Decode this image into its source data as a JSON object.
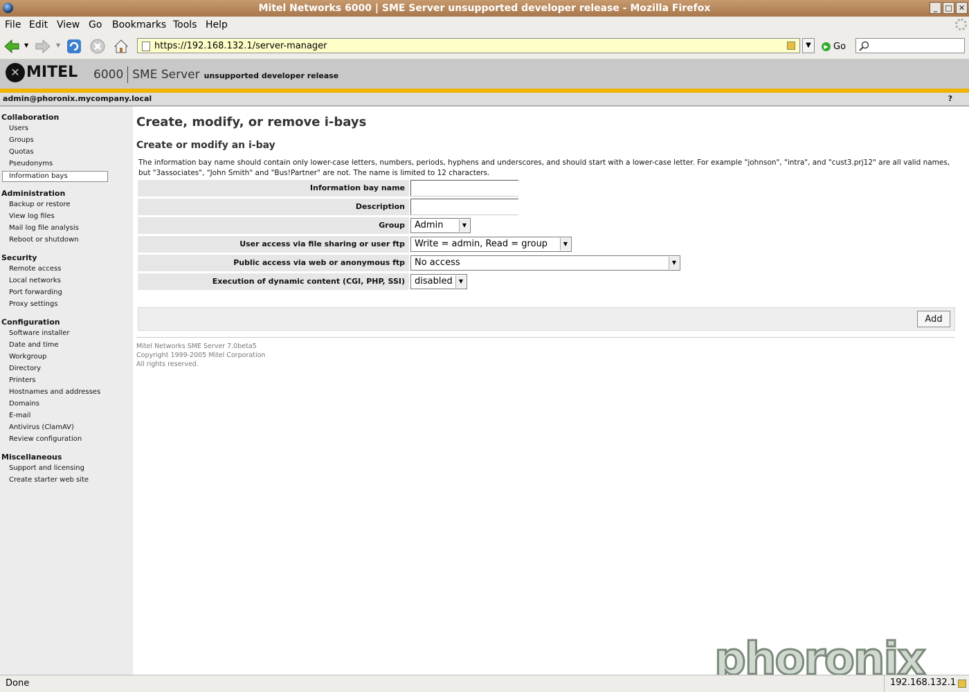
{
  "window": {
    "title": "Mitel Networks 6000 | SME Server unsupported developer release - Mozilla Firefox"
  },
  "menu": [
    {
      "label": "File"
    },
    {
      "label": "Edit"
    },
    {
      "label": "View"
    },
    {
      "label": "Go"
    },
    {
      "label": "Bookmarks"
    },
    {
      "label": "Tools"
    },
    {
      "label": "Help"
    }
  ],
  "nav": {
    "url": "https://192.168.132.1/server-manager",
    "go_label": "Go",
    "search_placeholder": ""
  },
  "header": {
    "logo": "MITEL",
    "model": "6000",
    "product": "SME Server",
    "release": "unsupported developer release"
  },
  "userbar": {
    "user": "admin@phoronix.mycompany.local",
    "help": "?"
  },
  "sidebar": {
    "collab_title": "Collaboration",
    "collab": [
      "Users",
      "Groups",
      "Quotas",
      "Pseudonyms",
      "Information bays"
    ],
    "admin_title": "Administration",
    "admin": [
      "Backup or restore",
      "View log files",
      "Mail log file analysis",
      "Reboot or shutdown"
    ],
    "security_title": "Security",
    "security": [
      "Remote access",
      "Local networks",
      "Port forwarding",
      "Proxy settings"
    ],
    "config_title": "Configuration",
    "config": [
      "Software installer",
      "Date and time",
      "Workgroup",
      "Directory",
      "Printers",
      "Hostnames and addresses",
      "Domains",
      "E-mail",
      "Antivirus (ClamAV)",
      "Review configuration"
    ],
    "misc_title": "Miscellaneous",
    "misc": [
      "Support and licensing",
      "Create starter web site"
    ]
  },
  "main": {
    "title": "Create, modify, or remove i-bays",
    "subtitle": "Create or modify an i-bay",
    "description": "The information bay name should contain only lower-case letters, numbers, periods, hyphens and underscores, and should start with a lower-case letter. For example \"johnson\", \"intra\", and \"cust3.prj12\" are all valid names, but \"3associates\", \"John Smith\" and \"Bus!Partner\" are not. The name is limited to 12 characters.",
    "fields": {
      "name_label": "Information bay name",
      "name_value": "",
      "desc_label": "Description",
      "desc_value": "",
      "group_label": "Group",
      "group_value": "Admin",
      "access_label": "User access via file sharing or user ftp",
      "access_value": "Write = admin, Read = group",
      "public_label": "Public access via web or anonymous ftp",
      "public_value": "No access",
      "exec_label": "Execution of dynamic content (CGI, PHP, SSI)",
      "exec_value": "disabled"
    },
    "add_button": "Add",
    "footer": [
      "Mitel Networks SME Server 7.0beta5",
      "Copyright 1999-2005 Mitel Corporation",
      "All rights reserved."
    ]
  },
  "watermark": "phoronix",
  "status": {
    "text": "Done",
    "host": "192.168.132.1"
  },
  "colors": {
    "accent_stripe": "#f0b400",
    "sidebar_bg": "#ececec",
    "url_bg": "#fefec8"
  }
}
